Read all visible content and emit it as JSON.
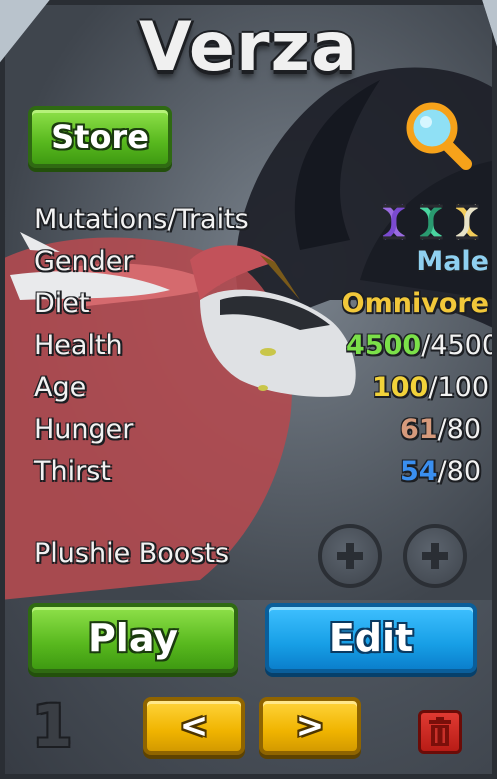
{
  "title": "Verza",
  "store_label": "Store",
  "stats": [
    {
      "label": "Mutations/Traits",
      "value": "",
      "max": ""
    },
    {
      "label": "Gender",
      "value": "Male",
      "max": "",
      "color": "#8fd0f0"
    },
    {
      "label": "Diet",
      "value": "Omnivore",
      "max": "",
      "color": "#f2c83a"
    },
    {
      "label": "Health",
      "value": "4500",
      "max": "/4500",
      "color": "#7be049"
    },
    {
      "label": "Age",
      "value": "100",
      "max": "/100",
      "color": "#f2d23a"
    },
    {
      "label": "Hunger",
      "value": "61",
      "max": "/80",
      "color": "#d69a7c"
    },
    {
      "label": "Thirst",
      "value": "54",
      "max": "/80",
      "color": "#3a8ff0"
    }
  ],
  "plushie_label": "Plushie Boosts",
  "play_label": "Play",
  "edit_label": "Edit",
  "prev_label": "<",
  "next_label": ">",
  "slot_number": "1",
  "icons": {
    "search": "magnifying-glass-icon",
    "traits": [
      "purple-dna-icon",
      "green-dna-icon",
      "yellow-dna-icon"
    ],
    "trash": "trash-icon",
    "plus": "plus-icon"
  },
  "colors": {
    "green_button": "#58b81e",
    "blue_button": "#179fe6",
    "yellow_button": "#f0b400",
    "red_button": "#b81c16"
  }
}
